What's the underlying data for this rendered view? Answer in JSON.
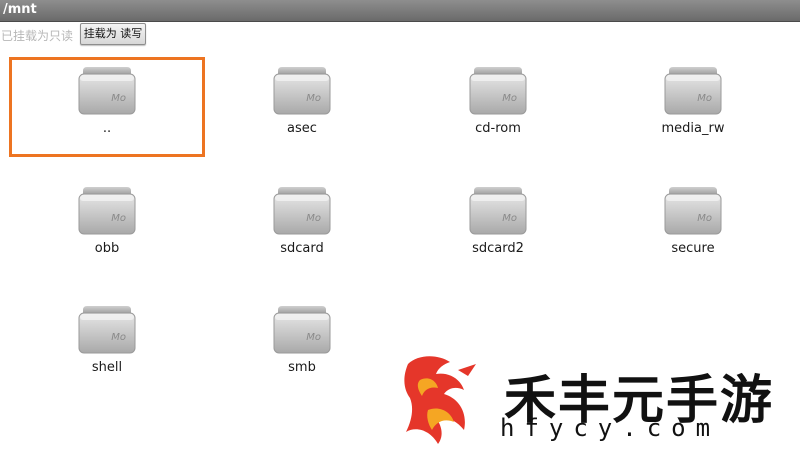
{
  "header": {
    "path": "/mnt"
  },
  "toolbar": {
    "mount_status": "已挂载为只读",
    "mount_button": "挂载为 读写"
  },
  "folder_badge": "Mo",
  "files": [
    {
      "name": "..",
      "selected": true
    },
    {
      "name": "asec",
      "selected": false
    },
    {
      "name": "cd-rom",
      "selected": false
    },
    {
      "name": "media_rw",
      "selected": false
    },
    {
      "name": "obb",
      "selected": false
    },
    {
      "name": "sdcard",
      "selected": false
    },
    {
      "name": "sdcard2",
      "selected": false
    },
    {
      "name": "secure",
      "selected": false
    },
    {
      "name": "shell",
      "selected": false
    },
    {
      "name": "smb",
      "selected": false
    }
  ],
  "watermark": {
    "title": "禾丰元手游",
    "url": "hfycy.com"
  },
  "colors": {
    "selection": "#ed7421",
    "titlebar": "#7a7a7a",
    "watermark_red": "#e5362a"
  }
}
